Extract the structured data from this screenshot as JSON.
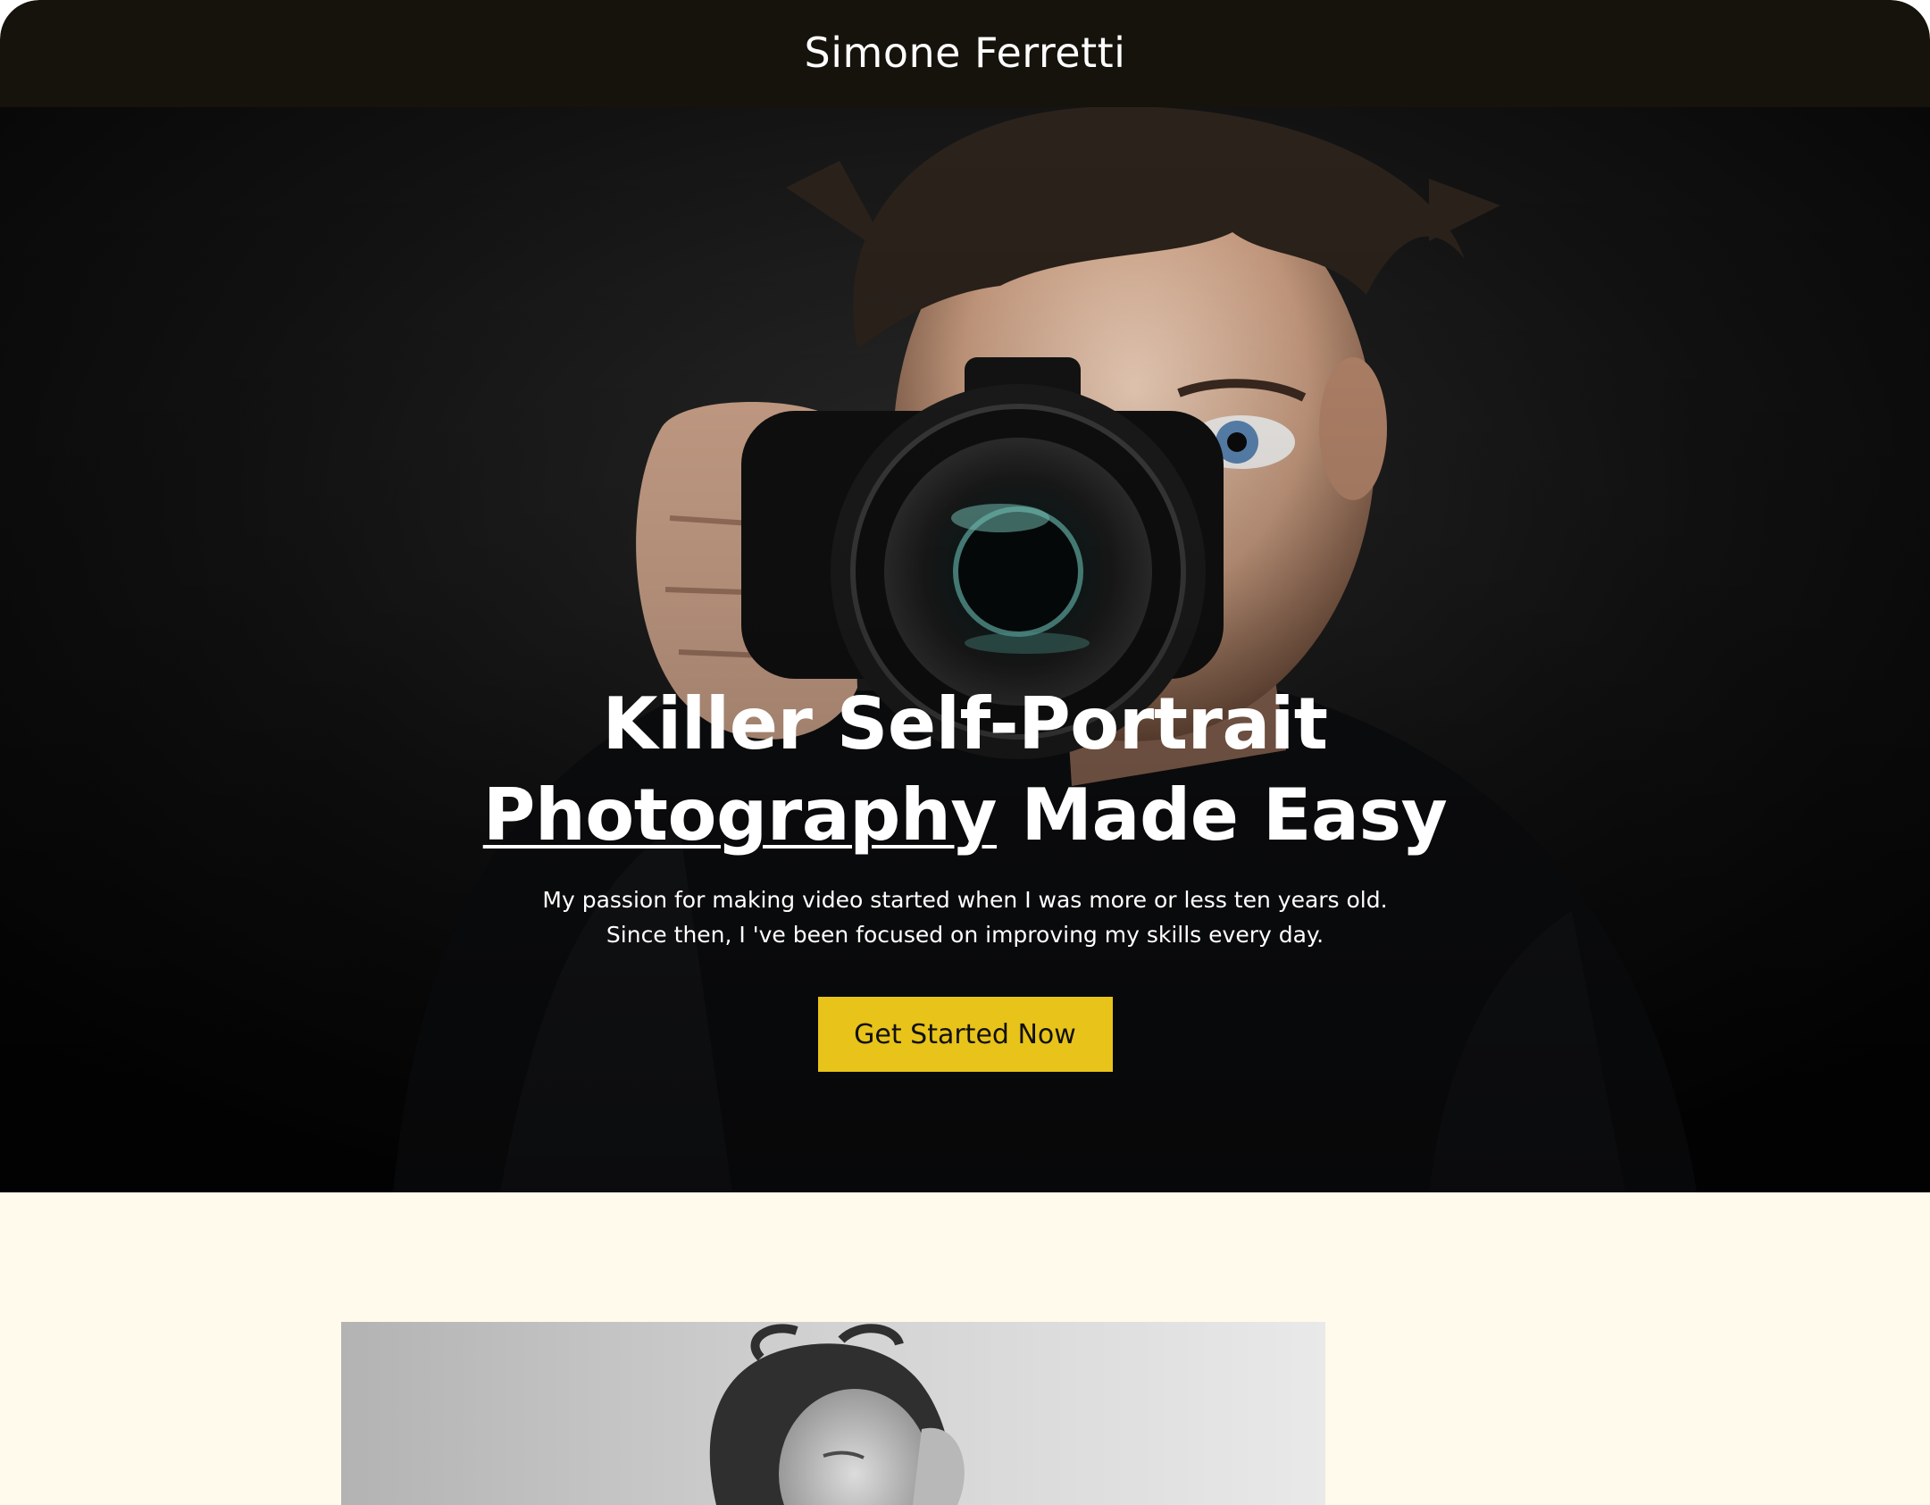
{
  "header": {
    "site_title": "Simone Ferretti",
    "background": "#15130b"
  },
  "hero": {
    "photo_alt": "Photographer holding a camera in front of his face",
    "heading_line1": "Killer Self-Portrait",
    "heading_underlined": "Photography",
    "heading_rest": " Made Easy",
    "subtitle_line1": "My passion for making video started when I was more or less ten years old.",
    "subtitle_line2": "Since then, I 've been focused on improving my skills every day.",
    "cta_label": "Get Started Now",
    "cta_color": "#e8c31a"
  },
  "section_two": {
    "background": "#fffaeb",
    "photo_alt": "Black and white portrait of a woman"
  }
}
